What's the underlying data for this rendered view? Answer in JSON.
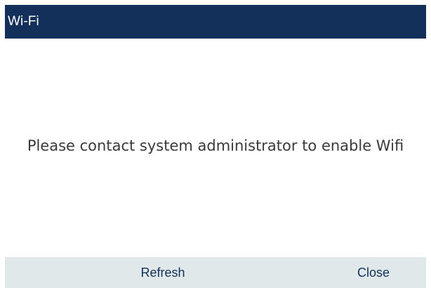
{
  "title_bar": {
    "title": "Wi-Fi"
  },
  "dialog": {
    "message": "Please contact system administrator to enable Wifi"
  },
  "softkeys": {
    "refresh_label": "Refresh",
    "close_label": "Close"
  },
  "colors": {
    "title_bar_bg": "#13305b",
    "title_text": "#ffffff",
    "softkey_bar_bg": "#e0e8ea",
    "softkey_text": "#13305b",
    "message_text": "#3a3a3a"
  }
}
